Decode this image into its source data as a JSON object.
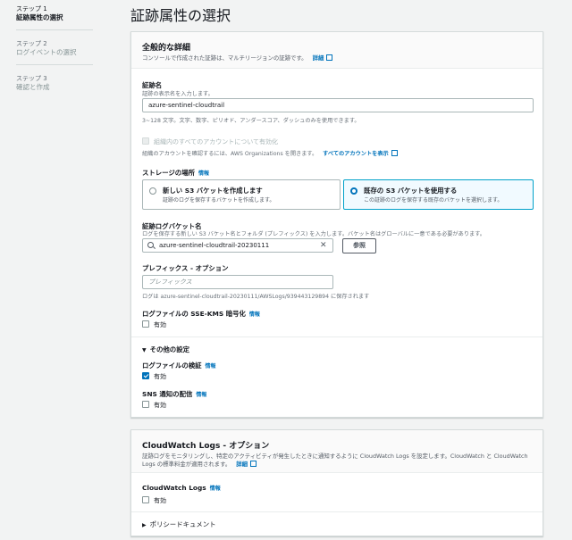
{
  "steps": [
    {
      "num": "ステップ 1",
      "label": "証跡属性の選択"
    },
    {
      "num": "ステップ 2",
      "label": "ログイベントの選択"
    },
    {
      "num": "ステップ 3",
      "label": "確認と作成"
    }
  ],
  "page_title": "証跡属性の選択",
  "general": {
    "title": "全般的な詳細",
    "desc": "コンソールで作成された証跡は、マルチリージョンの証跡です。",
    "desc_link": "詳細",
    "trail_name_label": "証跡名",
    "trail_name_hint": "証跡の表示名を入力します。",
    "trail_name_value": "azure-sentinel-cloudtrail",
    "trail_name_constraint": "3~128 文字。文字、数字、ピリオド、アンダースコア、ダッシュのみを使用できます。",
    "org_checkbox_label": "組織内のすべてのアカウントについて有効化",
    "org_hint": "組織のアカウントを確認するには、AWS Organizations を開きます。",
    "org_link": "すべてのアカウントを表示",
    "storage_label": "ストレージの場所",
    "info": "情報",
    "tile_new_title": "新しい S3 バケットを作成します",
    "tile_new_desc": "証跡のログを保存するバケットを作成します。",
    "tile_existing_title": "既存の S3 バケットを使用する",
    "tile_existing_desc": "この証跡のログを保存する既存のバケットを選択します。",
    "bucket_label": "証跡ログバケット名",
    "bucket_hint": "ログを保存する新しい S3 バケット名とフォルダ (プレフィックス) を入力します。バケット名はグローバルに一意である必要があります。",
    "bucket_value": "azure-sentinel-cloudtrail-20230111",
    "browse_button": "参照",
    "prefix_label": "プレフィックス - オプション",
    "prefix_placeholder": "プレフィックス",
    "prefix_hint": "ログは azure-sentinel-cloudtrail-20230111/AWSLogs/939443129894 に保存されます",
    "sse_label": "ログファイルの SSE-KMS 暗号化",
    "enabled": "有効",
    "other_settings": "その他の設定",
    "log_validation_label": "ログファイルの検証",
    "sns_label": "SNS 通知の配信"
  },
  "cloudwatch": {
    "title": "CloudWatch Logs - オプション",
    "desc_line1": "証跡ログをモニタリングし、特定のアクティビティが発生したときに通知するように CloudWatch Logs を設定します。CloudWatch と CloudWatch",
    "desc_line2": "Logs の標準料金が適用されます。",
    "desc_link": "詳細",
    "cw_label": "CloudWatch Logs",
    "info": "情報",
    "enabled": "有効",
    "policy_doc": "ポリシードキュメント"
  }
}
